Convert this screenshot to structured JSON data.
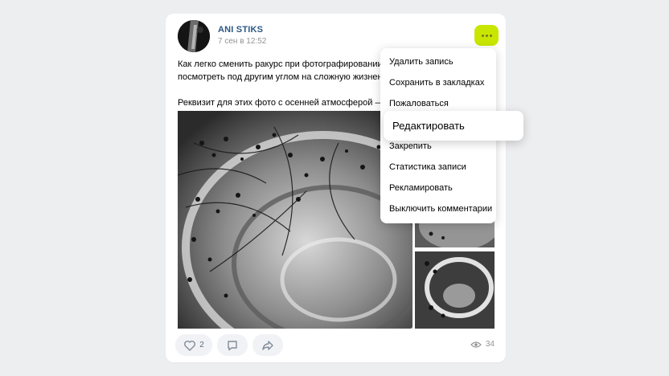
{
  "post": {
    "author": "ANI STIKS",
    "date": "7 сен в 12:52",
    "text_line1": "Как легко сменить ракурс при фотографировании и к",
    "text_line2": "посмотреть под другим углом на сложную жизненну",
    "text_line3": "Реквизит для этих фото с осенней атмосферой — бок",
    "likes": "2",
    "views": "34"
  },
  "menu": {
    "items": [
      "Удалить запись",
      "Сохранить в закладках",
      "Пожаловаться",
      "Редактировать",
      "Закрепить",
      "Статистика записи",
      "Рекламировать",
      "Выключить комментарии"
    ]
  },
  "colors": {
    "accent": "#c8e600",
    "link": "#2a5885",
    "background": "#edeef0"
  },
  "icons": [
    "more-icon",
    "like-icon",
    "comment-icon",
    "share-icon",
    "eye-icon"
  ]
}
